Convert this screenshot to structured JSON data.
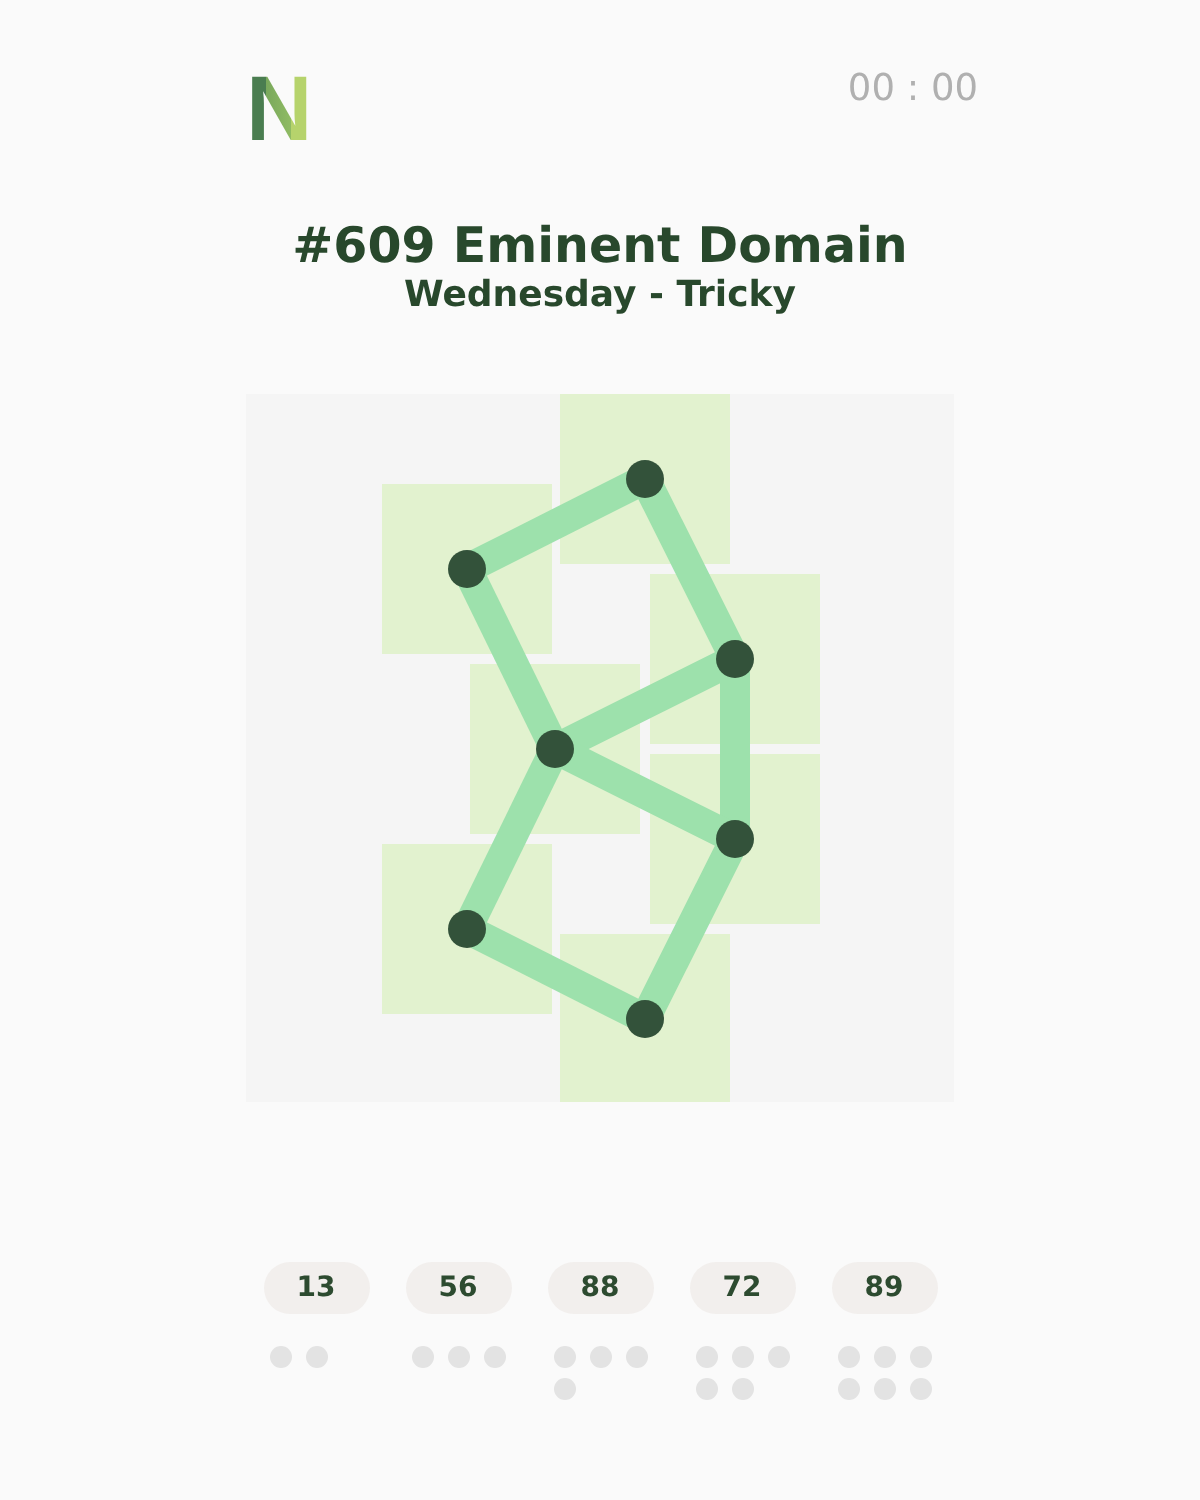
{
  "logo": "N",
  "timer": "00 : 00",
  "puzzle": {
    "title": "#609 Eminent Domain",
    "subtitle": "Wednesday - Tricky"
  },
  "scores": [
    {
      "value": "13",
      "dots": [
        {
          "filled": false
        },
        {
          "filled": false
        }
      ]
    },
    {
      "value": "56",
      "dots": [
        {
          "filled": false
        },
        {
          "filled": false
        },
        {
          "filled": false
        }
      ]
    },
    {
      "value": "88",
      "dots": [
        {
          "filled": false
        },
        {
          "filled": false
        },
        {
          "filled": false
        },
        {
          "filled": false
        }
      ]
    },
    {
      "value": "72",
      "dots": [
        {
          "filled": false
        },
        {
          "filled": false
        },
        {
          "filled": false
        },
        {
          "filled": false
        },
        {
          "filled": false
        }
      ]
    },
    {
      "value": "89",
      "dots": [
        {
          "filled": false
        },
        {
          "filled": false
        },
        {
          "filled": false
        },
        {
          "filled": false
        },
        {
          "filled": false
        },
        {
          "filled": false
        }
      ]
    }
  ]
}
